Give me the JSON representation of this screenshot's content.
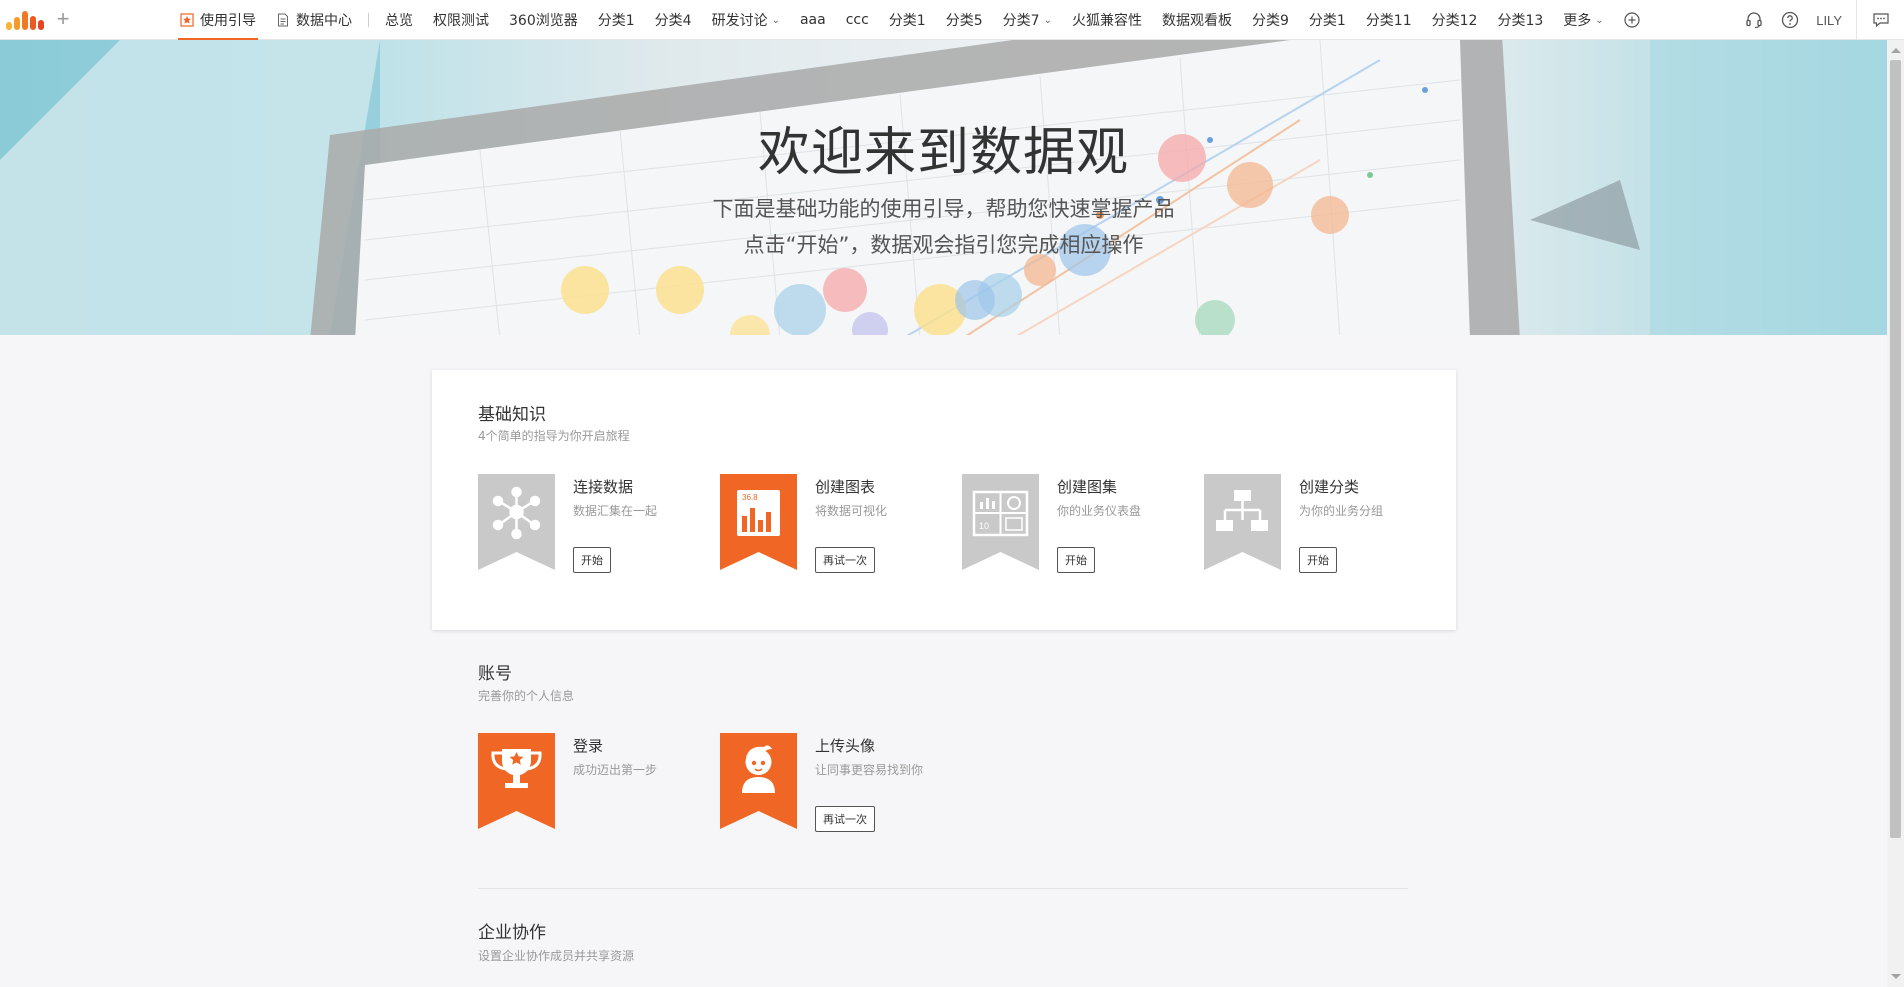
{
  "nav": {
    "tabs": [
      {
        "label": "使用引导",
        "icon": "guide-star-icon",
        "active": true
      },
      {
        "label": "数据中心",
        "icon": "document-icon",
        "active": false
      },
      {
        "label": "总览"
      },
      {
        "label": "权限测试"
      },
      {
        "label": "360浏览器"
      },
      {
        "label": "分类1"
      },
      {
        "label": "分类4"
      },
      {
        "label": "研发讨论",
        "dropdown": true
      },
      {
        "label": "aaa"
      },
      {
        "label": "ccc"
      },
      {
        "label": "分类1"
      },
      {
        "label": "分类5"
      },
      {
        "label": "分类7",
        "dropdown": true
      },
      {
        "label": "火狐兼容性"
      },
      {
        "label": "数据观看板"
      },
      {
        "label": "分类9"
      },
      {
        "label": "分类1"
      },
      {
        "label": "分类11"
      },
      {
        "label": "分类12"
      },
      {
        "label": "分类13"
      },
      {
        "label": "更多",
        "dropdown": true
      }
    ],
    "user": "LILY",
    "accent_color": "#f06625"
  },
  "hero": {
    "title": "欢迎来到数据观",
    "subtitle_line1": "下面是基础功能的使用引导，帮助您快速掌握产品",
    "subtitle_line2": "点击“开始”，数据观会指引您完成相应操作"
  },
  "basics": {
    "title": "基础知识",
    "description": "4个简单的指导为你开启旅程",
    "items": [
      {
        "title": "连接数据",
        "desc": "数据汇集在一起",
        "button": "开始",
        "icon": "network-nodes-icon",
        "completed": false
      },
      {
        "title": "创建图表",
        "desc": "将数据可视化",
        "button": "再试一次",
        "icon": "bar-chart-icon",
        "icon_text": "36.8",
        "completed": true
      },
      {
        "title": "创建图集",
        "desc": "你的业务仪表盘",
        "button": "开始",
        "icon": "dashboard-icon",
        "icon_text": "10",
        "completed": false
      },
      {
        "title": "创建分类",
        "desc": "为你的业务分组",
        "button": "开始",
        "icon": "hierarchy-icon",
        "completed": false
      }
    ]
  },
  "account": {
    "title": "账号",
    "description": "完善你的个人信息",
    "items": [
      {
        "title": "登录",
        "desc": "成功迈出第一步",
        "icon": "trophy-icon",
        "completed": true
      },
      {
        "title": "上传头像",
        "desc": "让同事更容易找到你",
        "button": "再试一次",
        "icon": "avatar-icon",
        "completed": true
      }
    ]
  },
  "enterprise": {
    "title": "企业协作",
    "description": "设置企业协作成员并共享资源"
  },
  "colors": {
    "completed_ribbon": "#f06625",
    "pending_ribbon": "#c9c9c9"
  }
}
